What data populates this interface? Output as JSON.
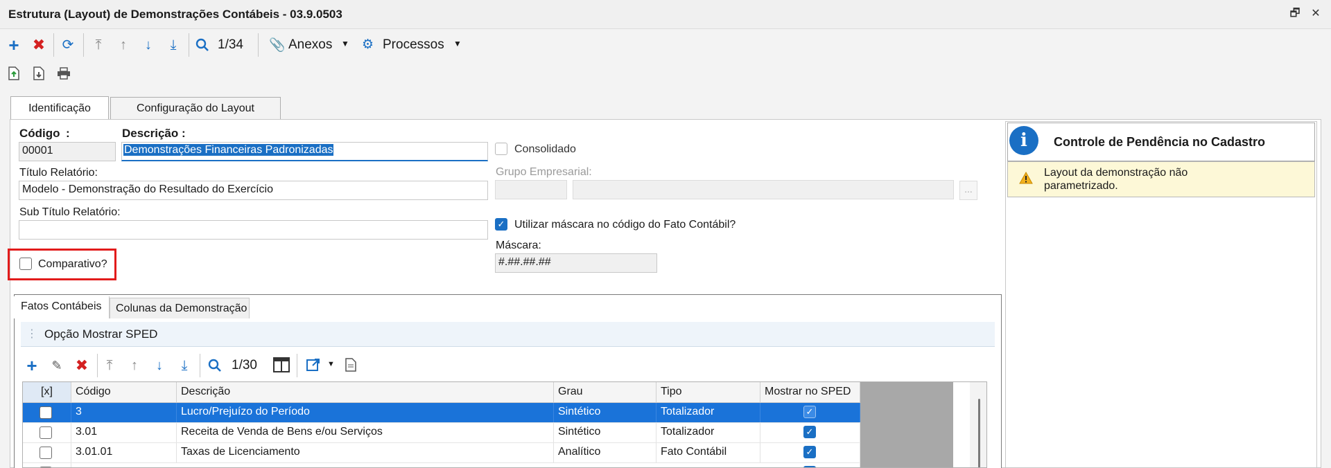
{
  "window": {
    "title": "Estrutura (Layout) de Demonstrações Contábeis - 03.9.0503",
    "restore_glyph": "🗗",
    "close_glyph": "✕"
  },
  "toolbar": {
    "record_counter": "1/34",
    "anexos_label": "Anexos",
    "processos_label": "Processos"
  },
  "tabs": [
    {
      "label": "Identificação",
      "active": true
    },
    {
      "label": "Configuração do Layout",
      "active": false
    }
  ],
  "form": {
    "codigo_label": "Código",
    "codigo_colon": ":",
    "codigo_value": "00001",
    "descricao_label": "Descrição",
    "descricao_colon": ":",
    "descricao_value": "Demonstrações Financeiras Padronizadas",
    "consolidado_label": "Consolidado",
    "titulo_label": "Título  Relatório:",
    "titulo_value": "Modelo - Demonstração do Resultado do Exercício",
    "grupo_label": "Grupo Empresarial:",
    "grupo_lookup_label": "...",
    "subtitulo_label": "Sub Título Relatório:",
    "subtitulo_value": "",
    "mascara_check_label": "Utilizar máscara no código do Fato Contábil?",
    "mascara_check_checked": true,
    "mascara_label": "Máscara:",
    "mascara_value": "#.##.##.##",
    "comparativo_label": "Comparativo?",
    "comparativo_checked": false
  },
  "pendencia": {
    "title": "Controle de Pendência no Cadastro",
    "message": "Layout da demonstração não parametrizado."
  },
  "subtabs": [
    {
      "label": "Fatos Contábeis",
      "active": true
    },
    {
      "label": "Colunas da Demonstração",
      "active": false
    }
  ],
  "group_bar": {
    "label": "Opção Mostrar SPED"
  },
  "grid_toolbar": {
    "record_counter": "1/30"
  },
  "grid": {
    "columns": [
      "[x]",
      "Código",
      "Descrição",
      "Grau",
      "Tipo",
      "Mostrar no SPED"
    ],
    "rows": [
      {
        "codigo": "3",
        "descricao": "Lucro/Prejuízo do Período",
        "grau": "Sintético",
        "tipo": "Totalizador",
        "sped": true,
        "selected": true
      },
      {
        "codigo": "3.01",
        "descricao": "Receita de Venda de Bens e/ou Serviços",
        "grau": "Sintético",
        "tipo": "Totalizador",
        "sped": true,
        "selected": false
      },
      {
        "codigo": "3.01.01",
        "descricao": "Taxas de Licenciamento",
        "grau": "Analítico",
        "tipo": "Fato Contábil",
        "sped": true,
        "selected": false
      }
    ]
  },
  "colors": {
    "accent": "#1a6fc4",
    "selection": "#1a73d9",
    "warning_bg": "#fdf8d7",
    "highlight_box": "#e21b1b",
    "grid_empty": "#a8a8a8"
  }
}
